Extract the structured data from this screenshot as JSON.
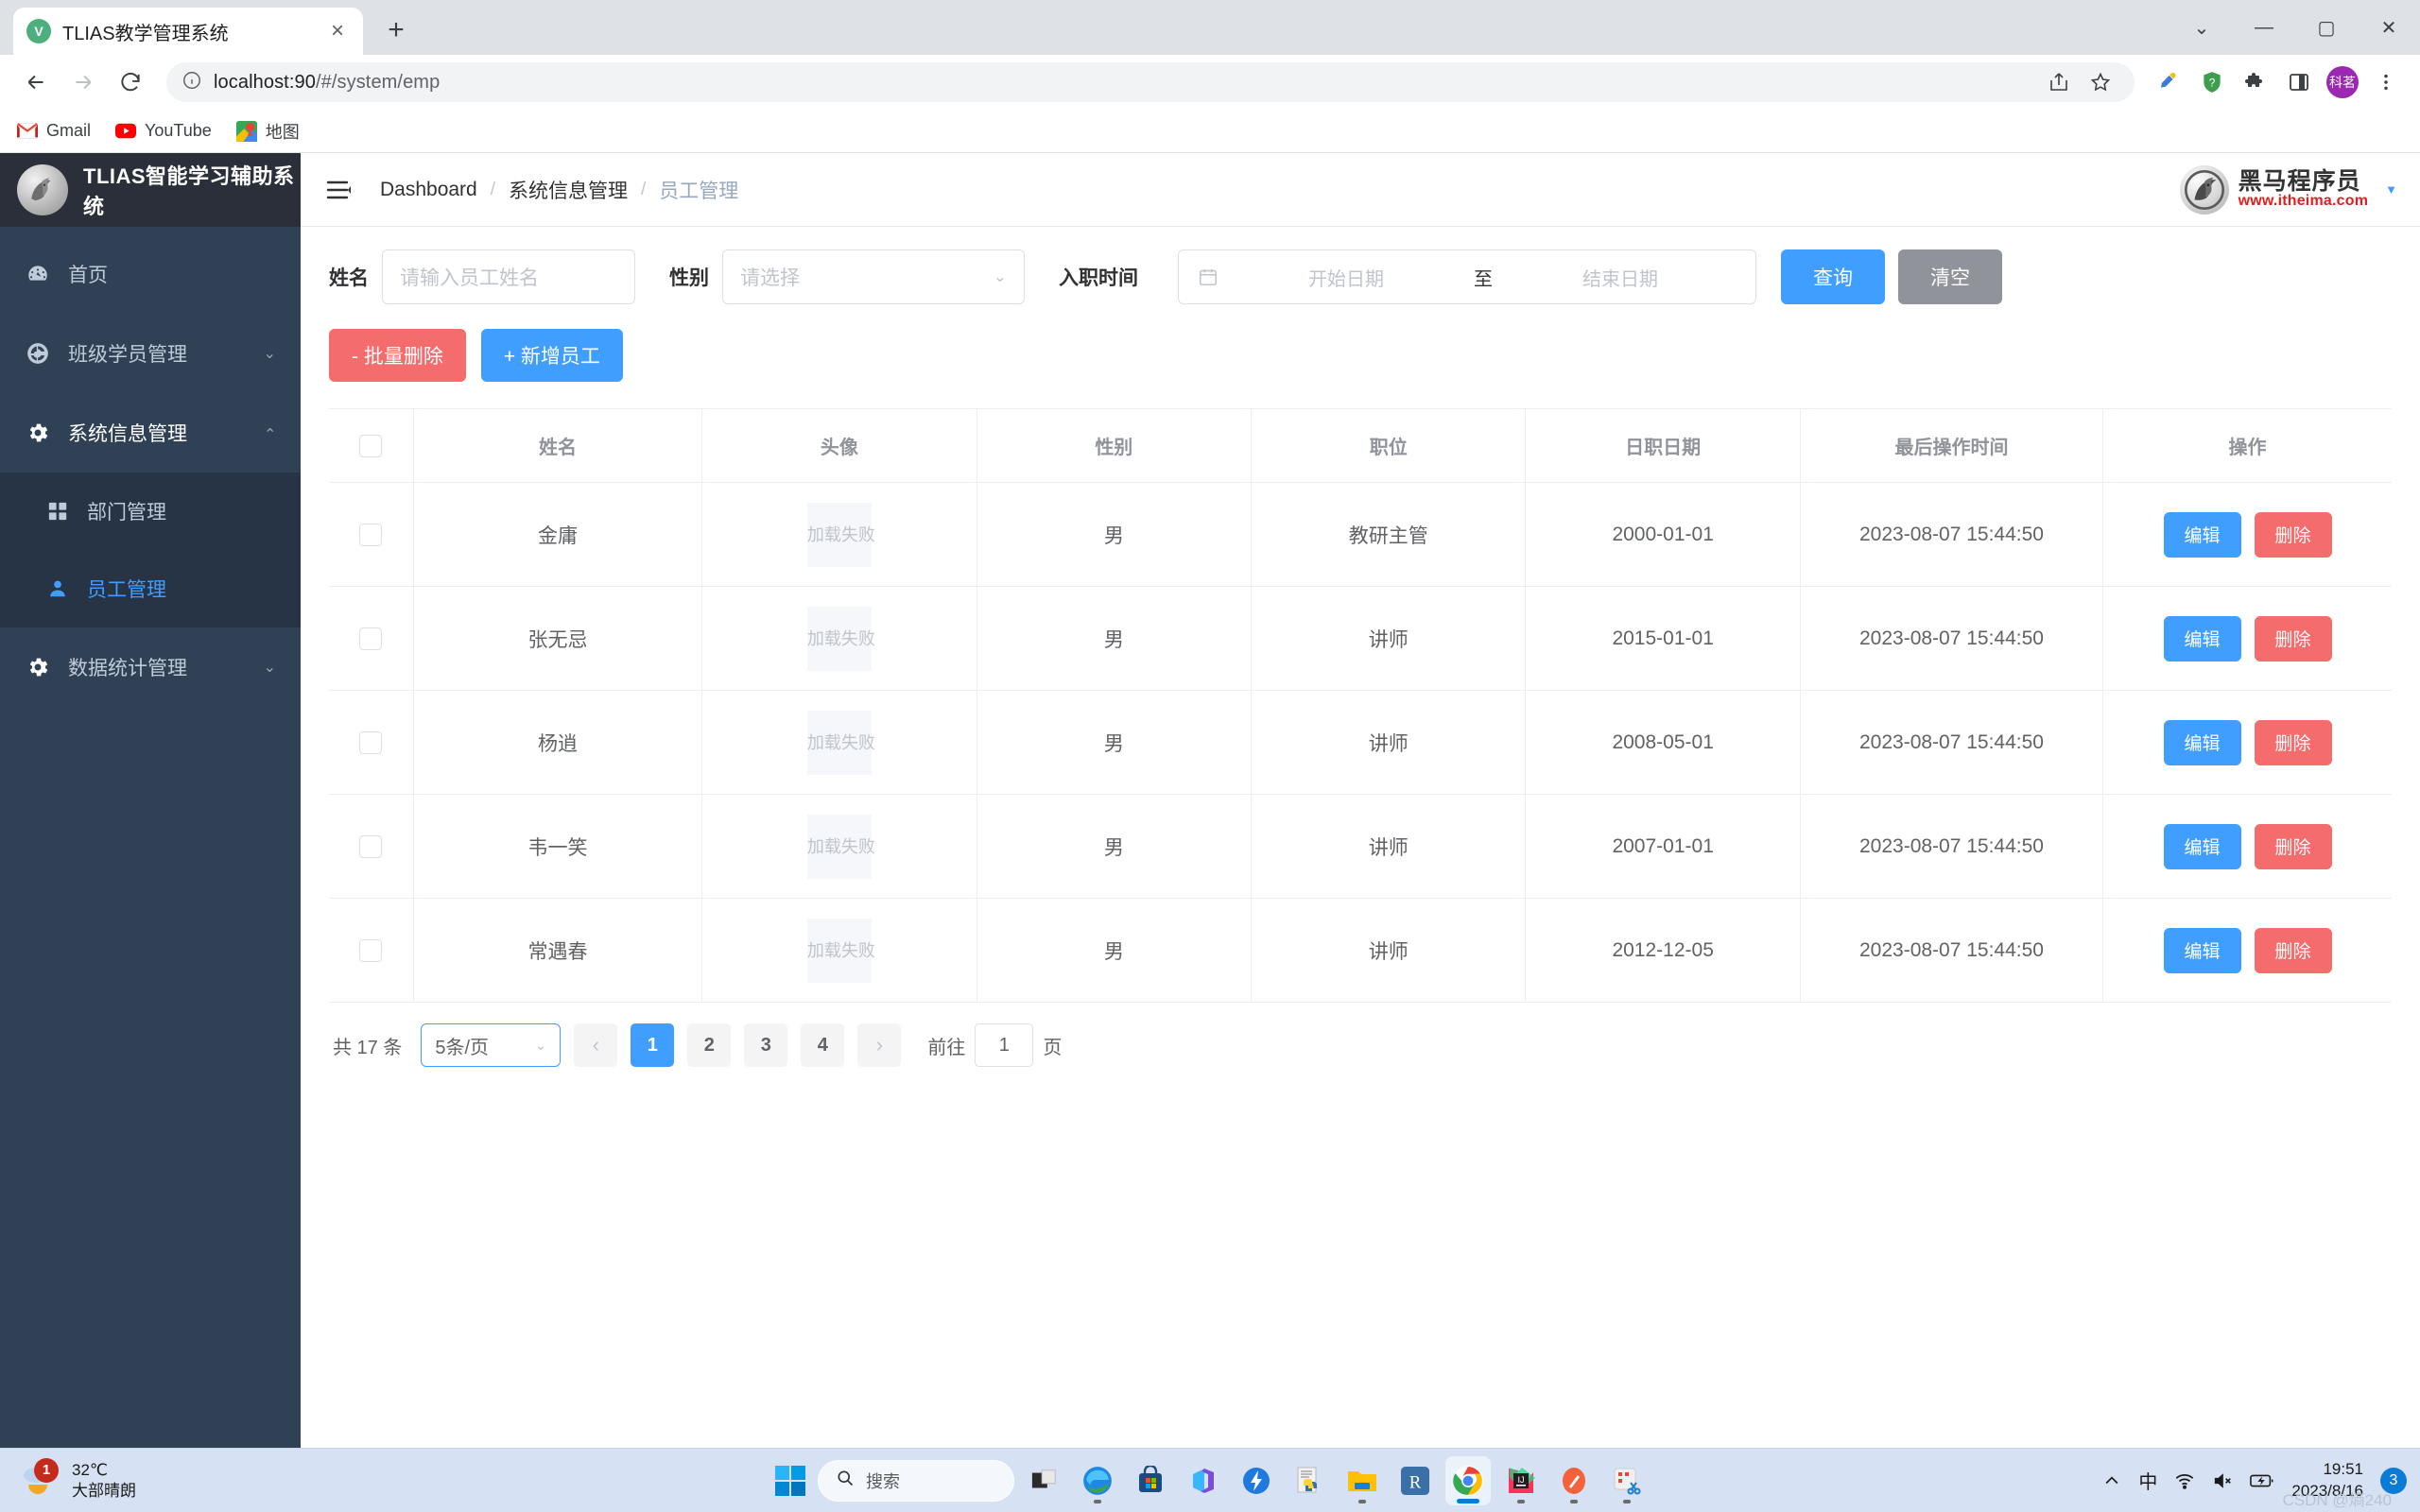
{
  "browser": {
    "tab": {
      "title": "TLIAS教学管理系统",
      "favicon_letter": "V",
      "close_label": "×"
    },
    "new_tab_label": "+",
    "window": {
      "minimize": "—",
      "maximize": "▢",
      "close": "✕",
      "more": "⌄"
    },
    "nav": {
      "back": "←",
      "forward": "→",
      "reload": "⟳"
    },
    "url": {
      "host": "localhost:90",
      "path": "/#/system/emp",
      "full": "localhost:90/#/system/emp"
    },
    "profile_initials": "科茗",
    "bookmarks": [
      {
        "label": "Gmail",
        "icon": "gmail-icon"
      },
      {
        "label": "YouTube",
        "icon": "youtube-icon"
      },
      {
        "label": "地图",
        "icon": "google-maps-icon"
      }
    ]
  },
  "sidebar": {
    "logo_text": "TLIAS智能学习辅助系统",
    "items": [
      {
        "label": "首页",
        "icon": "dashboard-icon",
        "expandable": false
      },
      {
        "label": "班级学员管理",
        "icon": "class-icon",
        "expandable": true,
        "expanded": false
      },
      {
        "label": "系统信息管理",
        "icon": "gear-icon",
        "expandable": true,
        "expanded": true
      },
      {
        "label": "数据统计管理",
        "icon": "gear-icon",
        "expandable": true,
        "expanded": false
      }
    ],
    "submenu": [
      {
        "label": "部门管理",
        "icon": "grid-icon",
        "active": false
      },
      {
        "label": "员工管理",
        "icon": "user-icon",
        "active": true
      }
    ]
  },
  "header": {
    "breadcrumb": [
      "Dashboard",
      "系统信息管理",
      "员工管理"
    ],
    "separator": "/",
    "brand_cn": "黑马程序员",
    "brand_url": "www.itheima.com"
  },
  "search": {
    "name_label": "姓名",
    "name_placeholder": "请输入员工姓名",
    "name_value": "",
    "gender_label": "性别",
    "gender_placeholder": "请选择",
    "gender_value": "",
    "date_label": "入职时间",
    "date_start_placeholder": "开始日期",
    "date_end_placeholder": "结束日期",
    "date_separator": "至",
    "query_button": "查询",
    "clear_button": "清空"
  },
  "actions": {
    "batch_delete": "- 批量删除",
    "add_employee": "+ 新增员工"
  },
  "table": {
    "columns": [
      "",
      "姓名",
      "头像",
      "性别",
      "职位",
      "日职日期",
      "最后操作时间",
      "操作"
    ],
    "avatar_failed_text": "加载失败",
    "edit_label": "编辑",
    "delete_label": "删除",
    "rows": [
      {
        "name": "金庸",
        "avatar": "加载失败",
        "gender": "男",
        "job": "教研主管",
        "hire_date": "2000-01-01",
        "last_op": "2023-08-07 15:44:50"
      },
      {
        "name": "张无忌",
        "avatar": "加载失败",
        "gender": "男",
        "job": "讲师",
        "hire_date": "2015-01-01",
        "last_op": "2023-08-07 15:44:50"
      },
      {
        "name": "杨逍",
        "avatar": "加载失败",
        "gender": "男",
        "job": "讲师",
        "hire_date": "2008-05-01",
        "last_op": "2023-08-07 15:44:50"
      },
      {
        "name": "韦一笑",
        "avatar": "加载失败",
        "gender": "男",
        "job": "讲师",
        "hire_date": "2007-01-01",
        "last_op": "2023-08-07 15:44:50"
      },
      {
        "name": "常遇春",
        "avatar": "加载失败",
        "gender": "男",
        "job": "讲师",
        "hire_date": "2012-12-05",
        "last_op": "2023-08-07 15:44:50"
      }
    ]
  },
  "pagination": {
    "total_text": "共 17 条",
    "page_size": "5条/页",
    "prev": "‹",
    "next": "›",
    "pages": [
      "1",
      "2",
      "3",
      "4"
    ],
    "active_page": "1",
    "goto_label": "前往",
    "goto_value": "1",
    "page_unit": "页"
  },
  "taskbar": {
    "weather_temp": "32℃",
    "weather_desc": "大部晴朗",
    "weather_badge": "1",
    "search_placeholder": "搜索",
    "tray_lang": "中",
    "time": "19:51",
    "date": "2023/8/16",
    "notification_count": "3",
    "watermark": "CSDN @熵240"
  },
  "colors": {
    "primary": "#409eff",
    "danger": "#f56c6c",
    "gray": "#909399",
    "sidebar": "#304156",
    "sidebar_dark": "#263445"
  }
}
